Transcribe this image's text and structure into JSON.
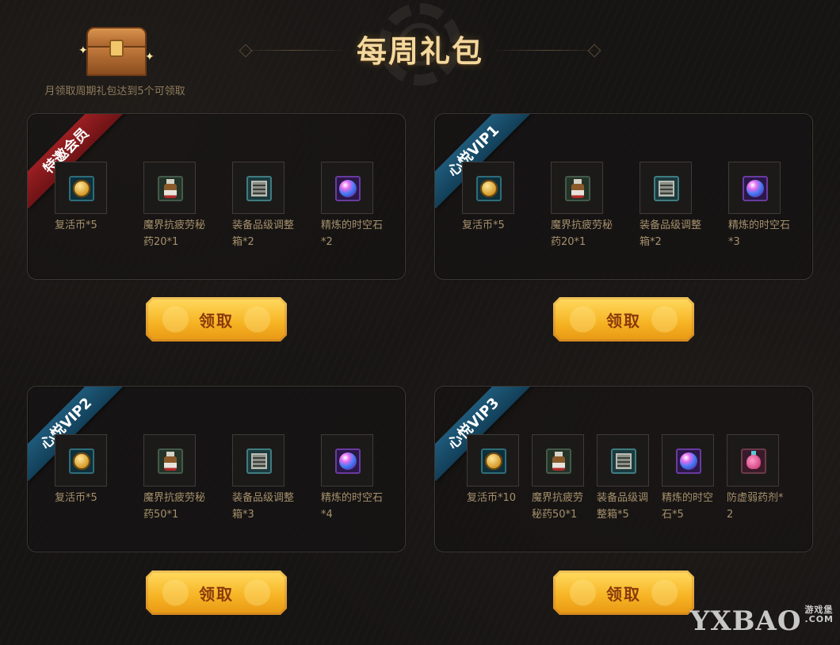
{
  "header": {
    "title": "每周礼包",
    "chest_text": "月领取周期礼包达到5个可领取"
  },
  "panels": [
    {
      "ribbon": "特邀会员",
      "ribbon_color": "#8e1b1e",
      "button_label": "领取",
      "items": [
        {
          "icon": "revive-coin-icon",
          "name": "复活币*5"
        },
        {
          "icon": "potion-icon",
          "name": "魔界抗疲劳秘药20*1"
        },
        {
          "icon": "equipment-box-icon",
          "name": "装备品级调整箱*2"
        },
        {
          "icon": "spacetime-orb-icon",
          "name": "精炼的时空石*2"
        }
      ]
    },
    {
      "ribbon": "心悦VIP1",
      "ribbon_color": "#1b4f6e",
      "button_label": "领取",
      "items": [
        {
          "icon": "revive-coin-icon",
          "name": "复活币*5"
        },
        {
          "icon": "potion-icon",
          "name": "魔界抗疲劳秘药20*1"
        },
        {
          "icon": "equipment-box-icon",
          "name": "装备品级调整箱*2"
        },
        {
          "icon": "spacetime-orb-icon",
          "name": "精炼的时空石*3"
        }
      ]
    },
    {
      "ribbon": "心悦VIP2",
      "ribbon_color": "#1b4f6e",
      "button_label": "领取",
      "items": [
        {
          "icon": "revive-coin-icon",
          "name": "复活币*5"
        },
        {
          "icon": "potion-icon",
          "name": "魔界抗疲劳秘药50*1"
        },
        {
          "icon": "equipment-box-icon",
          "name": "装备品级调整箱*3"
        },
        {
          "icon": "spacetime-orb-icon",
          "name": "精炼的时空石*4"
        }
      ]
    },
    {
      "ribbon": "心悦VIP3",
      "ribbon_color": "#1b4f6e",
      "button_label": "领取",
      "items": [
        {
          "icon": "revive-coin-icon",
          "name": "复活币*10"
        },
        {
          "icon": "potion-icon",
          "name": "魔界抗疲劳秘药50*1"
        },
        {
          "icon": "equipment-box-icon",
          "name": "装备品级调整箱*5"
        },
        {
          "icon": "spacetime-orb-icon",
          "name": "精炼的时空石*5"
        },
        {
          "icon": "flask-icon",
          "name": "防虚弱药剂*2"
        }
      ]
    }
  ],
  "watermark": {
    "text": "YXBAO",
    "sub1": "游戏堡",
    "sub2": ".COM"
  }
}
